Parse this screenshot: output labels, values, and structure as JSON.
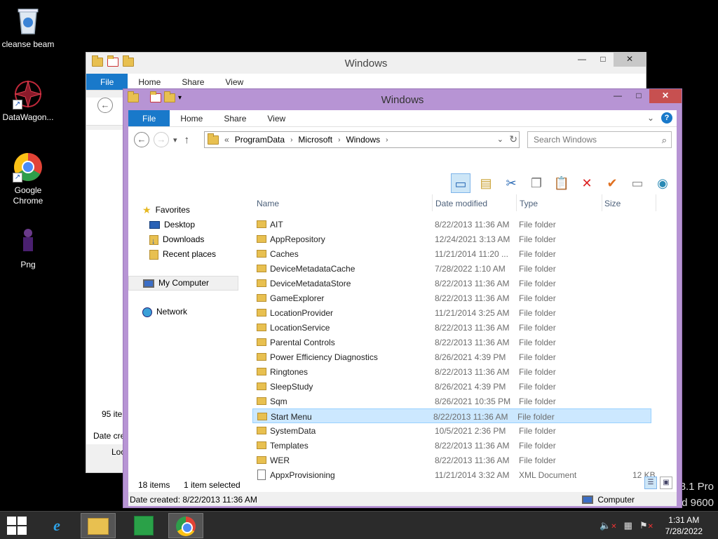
{
  "desktop": {
    "icons": [
      {
        "label": "cleanse beam",
        "icon": "recycle-bin-icon"
      },
      {
        "label": "DataWagon...",
        "icon": "datawagon-icon"
      },
      {
        "label": "Google Chrome",
        "icon": "chrome-icon"
      },
      {
        "label": "Png",
        "icon": "png-figure-icon"
      }
    ],
    "watermark": [
      "8.1 Pro",
      "d 9600"
    ]
  },
  "back_window": {
    "title": "Windows",
    "tabs": [
      "File",
      "Home",
      "Share",
      "View"
    ],
    "status_count": "95 ite",
    "status_created": "Date cre",
    "status_loc": "Loc"
  },
  "window": {
    "title": "Windows",
    "tabs": [
      "File",
      "Home",
      "Share",
      "View"
    ],
    "address": {
      "prefix": "«",
      "crumbs": [
        "ProgramData",
        "Microsoft",
        "Windows"
      ]
    },
    "search_placeholder": "Search Windows",
    "nav_pane": {
      "favorites": "Favorites",
      "desktop": "Desktop",
      "downloads": "Downloads",
      "recent": "Recent places",
      "computer": "My Computer",
      "network": "Network"
    },
    "columns": {
      "name": "Name",
      "date": "Date modified",
      "type": "Type",
      "size": "Size"
    },
    "files": [
      {
        "name": "AIT",
        "date": "8/22/2013 11:36 AM",
        "type": "File folder",
        "size": ""
      },
      {
        "name": "AppRepository",
        "date": "12/24/2021 3:13 AM",
        "type": "File folder",
        "size": ""
      },
      {
        "name": "Caches",
        "date": "11/21/2014 11:20 ...",
        "type": "File folder",
        "size": ""
      },
      {
        "name": "DeviceMetadataCache",
        "date": "7/28/2022 1:10 AM",
        "type": "File folder",
        "size": ""
      },
      {
        "name": "DeviceMetadataStore",
        "date": "8/22/2013 11:36 AM",
        "type": "File folder",
        "size": ""
      },
      {
        "name": "GameExplorer",
        "date": "8/22/2013 11:36 AM",
        "type": "File folder",
        "size": ""
      },
      {
        "name": "LocationProvider",
        "date": "11/21/2014 3:25 AM",
        "type": "File folder",
        "size": ""
      },
      {
        "name": "LocationService",
        "date": "8/22/2013 11:36 AM",
        "type": "File folder",
        "size": ""
      },
      {
        "name": "Parental Controls",
        "date": "8/22/2013 11:36 AM",
        "type": "File folder",
        "size": ""
      },
      {
        "name": "Power Efficiency Diagnostics",
        "date": "8/26/2021 4:39 PM",
        "type": "File folder",
        "size": ""
      },
      {
        "name": "Ringtones",
        "date": "8/22/2013 11:36 AM",
        "type": "File folder",
        "size": ""
      },
      {
        "name": "SleepStudy",
        "date": "8/26/2021 4:39 PM",
        "type": "File folder",
        "size": ""
      },
      {
        "name": "Sqm",
        "date": "8/26/2021 10:35 PM",
        "type": "File folder",
        "size": ""
      },
      {
        "name": "Start Menu",
        "date": "8/22/2013 11:36 AM",
        "type": "File folder",
        "size": "",
        "selected": true
      },
      {
        "name": "SystemData",
        "date": "10/5/2021 2:36 PM",
        "type": "File folder",
        "size": ""
      },
      {
        "name": "Templates",
        "date": "8/22/2013 11:36 AM",
        "type": "File folder",
        "size": ""
      },
      {
        "name": "WER",
        "date": "8/22/2013 11:36 AM",
        "type": "File folder",
        "size": ""
      },
      {
        "name": "AppxProvisioning",
        "date": "11/21/2014 3:32 AM",
        "type": "XML Document",
        "size": "12 KB",
        "xml": true
      }
    ],
    "status": {
      "count": "18 items",
      "selected": "1 item selected"
    },
    "details": {
      "date_created": "Date created: 8/22/2013 11:36 AM",
      "location": "Computer"
    }
  },
  "taskbar": {
    "clock_time": "1:31 AM",
    "clock_date": "7/28/2022"
  }
}
